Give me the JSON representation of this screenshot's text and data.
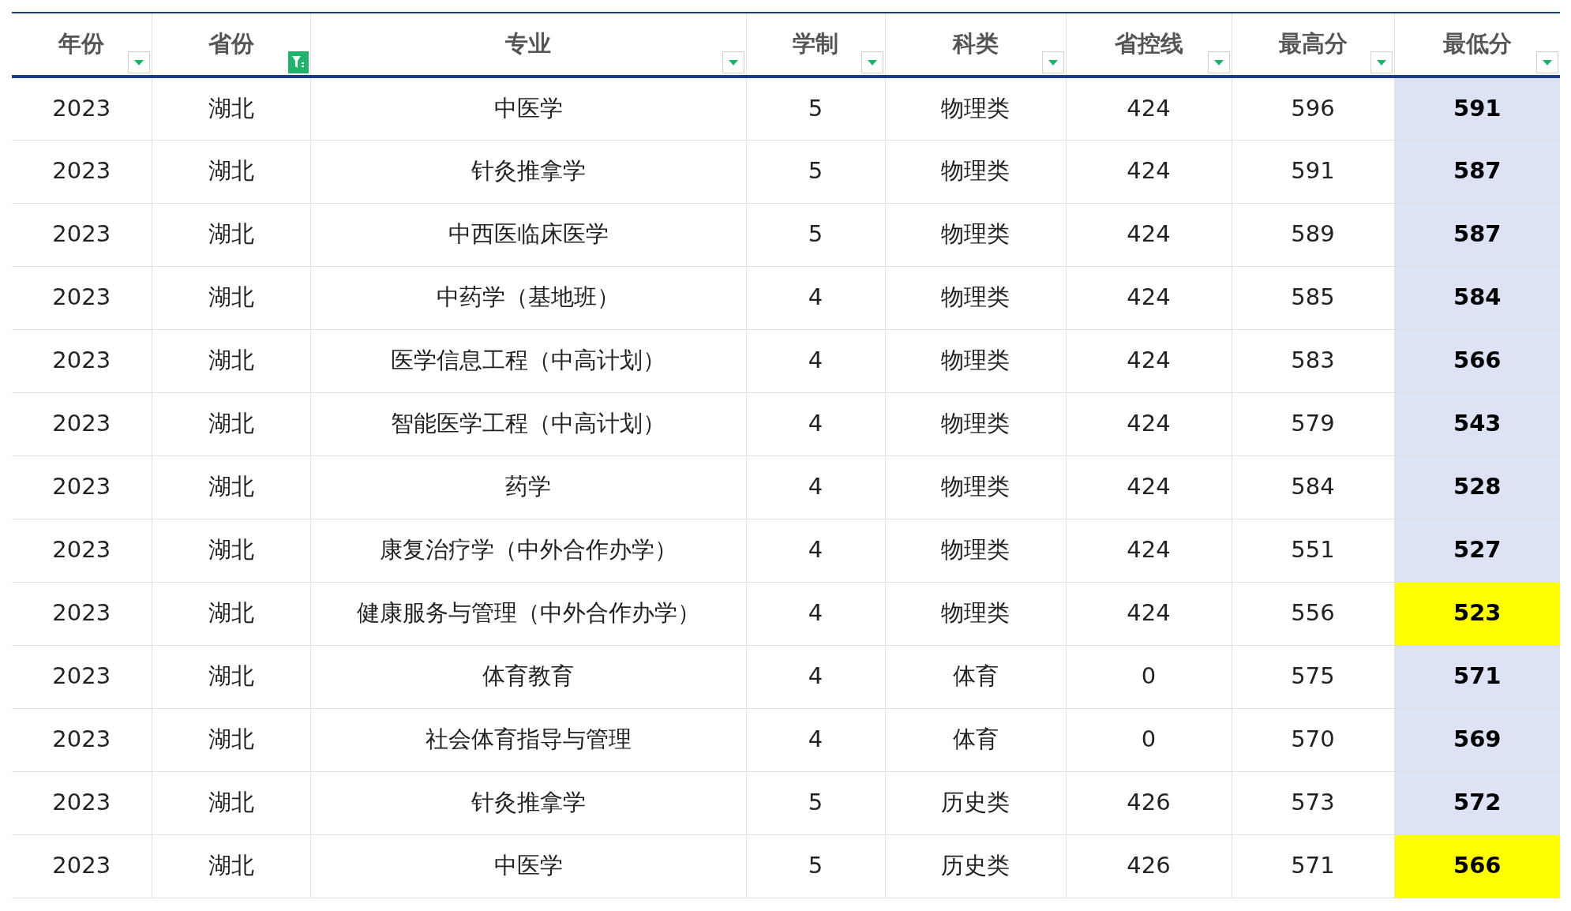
{
  "table": {
    "columns": [
      {
        "label": "年份",
        "filter_active": false
      },
      {
        "label": "省份",
        "filter_active": true
      },
      {
        "label": "专业",
        "filter_active": false
      },
      {
        "label": "学制",
        "filter_active": false
      },
      {
        "label": "科类",
        "filter_active": false
      },
      {
        "label": "省控线",
        "filter_active": false
      },
      {
        "label": "最高分",
        "filter_active": false
      },
      {
        "label": "最低分",
        "filter_active": false
      }
    ],
    "rows": [
      {
        "cells": [
          "2023",
          "湖北",
          "中医学",
          "5",
          "物理类",
          "424",
          "596",
          "591"
        ],
        "highlighted": false
      },
      {
        "cells": [
          "2023",
          "湖北",
          "针灸推拿学",
          "5",
          "物理类",
          "424",
          "591",
          "587"
        ],
        "highlighted": false
      },
      {
        "cells": [
          "2023",
          "湖北",
          "中西医临床医学",
          "5",
          "物理类",
          "424",
          "589",
          "587"
        ],
        "highlighted": false
      },
      {
        "cells": [
          "2023",
          "湖北",
          "中药学（基地班）",
          "4",
          "物理类",
          "424",
          "585",
          "584"
        ],
        "highlighted": false
      },
      {
        "cells": [
          "2023",
          "湖北",
          "医学信息工程（中高计划）",
          "4",
          "物理类",
          "424",
          "583",
          "566"
        ],
        "highlighted": false
      },
      {
        "cells": [
          "2023",
          "湖北",
          "智能医学工程（中高计划）",
          "4",
          "物理类",
          "424",
          "579",
          "543"
        ],
        "highlighted": false
      },
      {
        "cells": [
          "2023",
          "湖北",
          "药学",
          "4",
          "物理类",
          "424",
          "584",
          "528"
        ],
        "highlighted": false
      },
      {
        "cells": [
          "2023",
          "湖北",
          "康复治疗学（中外合作办学）",
          "4",
          "物理类",
          "424",
          "551",
          "527"
        ],
        "highlighted": false
      },
      {
        "cells": [
          "2023",
          "湖北",
          "健康服务与管理（中外合作办学）",
          "4",
          "物理类",
          "424",
          "556",
          "523"
        ],
        "highlighted": true
      },
      {
        "cells": [
          "2023",
          "湖北",
          "体育教育",
          "4",
          "体育",
          "0",
          "575",
          "571"
        ],
        "highlighted": false
      },
      {
        "cells": [
          "2023",
          "湖北",
          "社会体育指导与管理",
          "4",
          "体育",
          "0",
          "570",
          "569"
        ],
        "highlighted": false
      },
      {
        "cells": [
          "2023",
          "湖北",
          "针灸推拿学",
          "5",
          "历史类",
          "426",
          "573",
          "572"
        ],
        "highlighted": false
      },
      {
        "cells": [
          "2023",
          "湖北",
          "中医学",
          "5",
          "历史类",
          "426",
          "571",
          "566"
        ],
        "highlighted": true
      }
    ]
  }
}
